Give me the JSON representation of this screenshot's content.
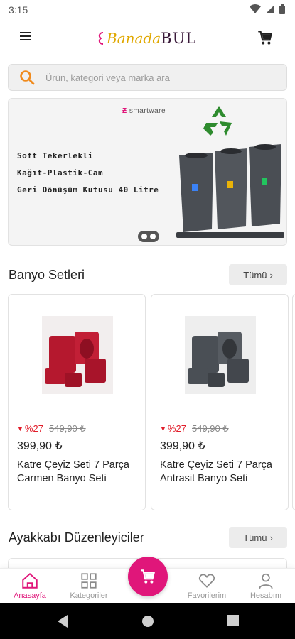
{
  "status_bar": {
    "time": "3:15",
    "icons": [
      "wifi-icon",
      "signal-icon",
      "battery-icon"
    ]
  },
  "header": {
    "logo_part1": "Banada",
    "logo_part2": "BUL",
    "menu_icon": "hamburger-menu-icon",
    "cart_icon": "shopping-cart-icon"
  },
  "search": {
    "placeholder": "Ürün, kategori veya marka ara",
    "icon": "search-icon"
  },
  "banner": {
    "brand": "smartware",
    "lines": [
      "Soft Tekerlekli",
      "Kağıt-Plastik-Cam",
      "Geri Dönüşüm Kutusu 40 Litre"
    ]
  },
  "sections": [
    {
      "title": "Banyo Setleri",
      "all_label": "Tümü",
      "products": [
        {
          "discount": "%27",
          "old_price": "549,90 ₺",
          "price": "399,90 ₺",
          "name": "Katre Çeyiz Seti 7 Parça Carmen Banyo Seti",
          "color": "#b5182e"
        },
        {
          "discount": "%27",
          "old_price": "549,90 ₺",
          "price": "399,90 ₺",
          "name": "Katre Çeyiz Seti 7 Parça Antrasit Banyo Seti",
          "color": "#4a4f55"
        }
      ]
    },
    {
      "title": "Ayakkabı Düzenleyiciler",
      "all_label": "Tümü"
    }
  ],
  "bottom_nav": {
    "items": [
      {
        "label": "Anasayfa",
        "icon": "home-icon",
        "active": true
      },
      {
        "label": "Kategoriler",
        "icon": "grid-icon",
        "active": false
      },
      {
        "label": "Favorilerim",
        "icon": "heart-icon",
        "active": false
      },
      {
        "label": "Hesabım",
        "icon": "user-icon",
        "active": false
      }
    ],
    "fab_icon": "shopping-cart-icon"
  },
  "colors": {
    "accent": "#e0167a",
    "discount": "#e11d2a",
    "search_icon": "#f08a1c"
  }
}
